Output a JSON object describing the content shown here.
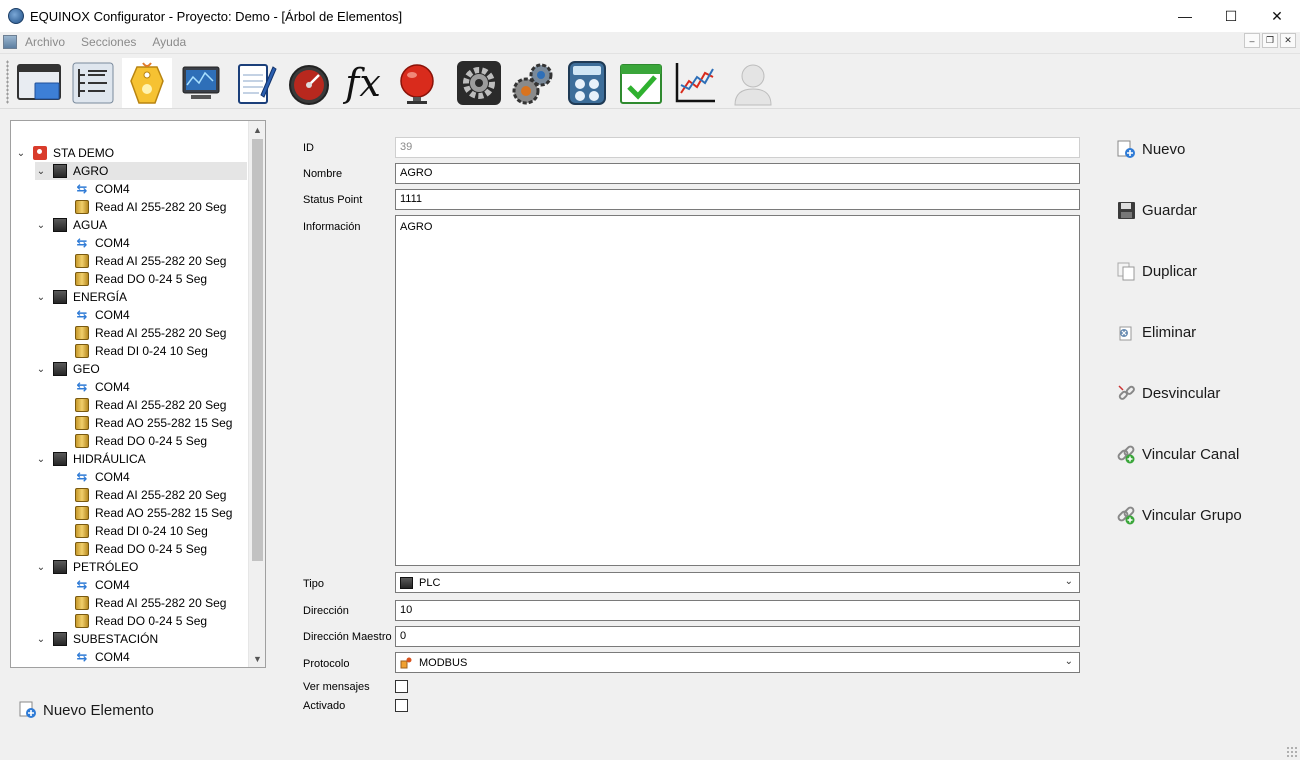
{
  "window": {
    "title": "EQUINOX Configurator - Proyecto: Demo - [Árbol de Elementos]",
    "minimize": "—",
    "maximize": "☐",
    "close": "✕"
  },
  "menu": {
    "items": [
      "Archivo",
      "Secciones",
      "Ayuda"
    ],
    "mdi_min": "‒",
    "mdi_restore": "❐",
    "mdi_close": "✕"
  },
  "toolbar": {
    "icons": [
      "window-icon",
      "tree-list-icon",
      "tag-icon",
      "monitor-icon",
      "notepad-icon",
      "gauge-icon",
      "fx-icon",
      "alarm-bell-icon",
      "settings-gear-icon",
      "gears-icon",
      "calculator-icon",
      "calendar-check-icon",
      "line-chart-icon",
      "user-icon"
    ],
    "active_index": 2,
    "fx_text": "fx"
  },
  "tree": {
    "root": "STA DEMO",
    "nodes": [
      {
        "label": "AGRO",
        "children": [
          "COM4",
          "Read AI 255-282 20 Seg"
        ]
      },
      {
        "label": "AGUA",
        "children": [
          "COM4",
          "Read AI 255-282 20 Seg",
          "Read DO 0-24 5 Seg"
        ]
      },
      {
        "label": "ENERGÍA",
        "children": [
          "COM4",
          "Read AI 255-282 20 Seg",
          "Read DI 0-24 10 Seg"
        ]
      },
      {
        "label": "GEO",
        "children": [
          "COM4",
          "Read AI 255-282 20 Seg",
          "Read AO 255-282 15 Seg",
          "Read DO 0-24 5 Seg"
        ]
      },
      {
        "label": "HIDRÁULICA",
        "children": [
          "COM4",
          "Read AI 255-282 20 Seg",
          "Read AO 255-282 15 Seg",
          "Read DI 0-24 10 Seg",
          "Read DO 0-24 5 Seg"
        ]
      },
      {
        "label": "PETRÓLEO",
        "children": [
          "COM4",
          "Read AI 255-282 20 Seg",
          "Read DO 0-24 5 Seg"
        ]
      },
      {
        "label": "SUBESTACIÓN",
        "children": [
          "COM4"
        ]
      }
    ],
    "selected": "AGRO",
    "scroll_up": "▲",
    "scroll_down": "▼"
  },
  "new_element_label": "Nuevo Elemento",
  "form": {
    "id_label": "ID",
    "id_value": "39",
    "nombre_label": "Nombre",
    "nombre_value": "AGRO",
    "status_label": "Status Point",
    "status_value": "1111",
    "info_label": "Información",
    "info_value": "AGRO",
    "tipo_label": "Tipo",
    "tipo_value": "PLC",
    "direccion_label": "Dirección",
    "direccion_value": "10",
    "maestro_label": "Dirección Maestro",
    "maestro_value": "0",
    "protocolo_label": "Protocolo",
    "protocolo_value": "MODBUS",
    "ver_mensajes_label": "Ver mensajes",
    "ver_mensajes_checked": false,
    "activado_label": "Activado",
    "activado_checked": false,
    "caret": "⌄"
  },
  "actions": {
    "nuevo": "Nuevo",
    "guardar": "Guardar",
    "duplicar": "Duplicar",
    "eliminar": "Eliminar",
    "desvincular": "Desvincular",
    "vincular_canal": "Vincular Canal",
    "vincular_grupo": "Vincular Grupo"
  },
  "colors": {
    "selected_row": "#e5e5e5",
    "accent_blue": "#2f7bd6",
    "root_pin": "#d93b2b"
  }
}
